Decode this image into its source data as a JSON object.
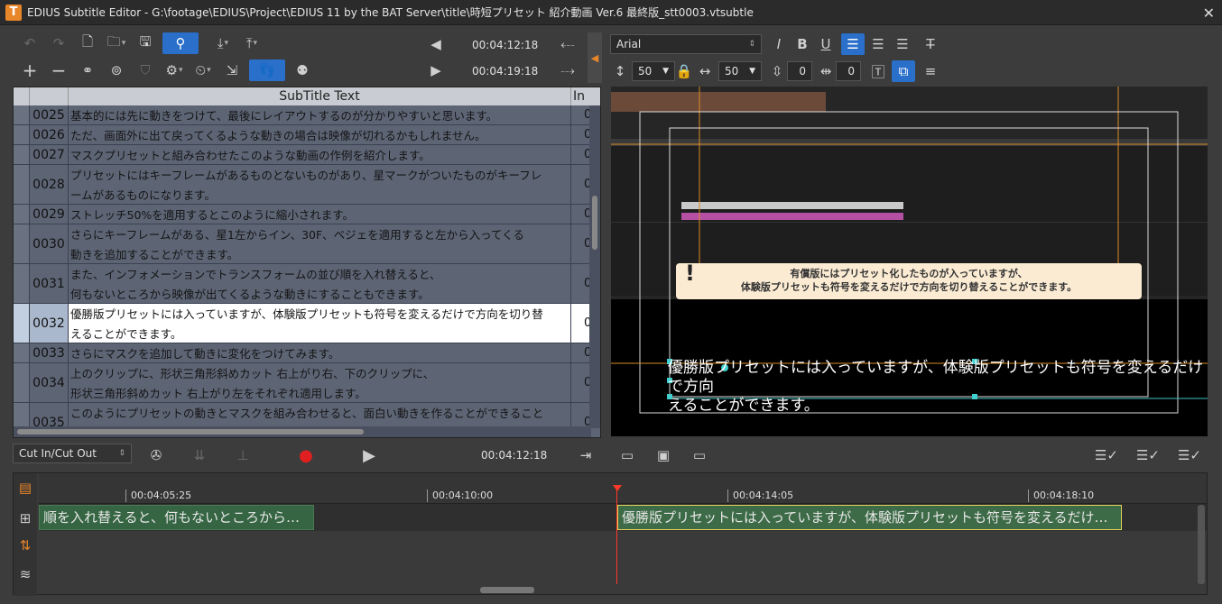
{
  "window": {
    "title": "EDIUS Subtitle Editor - G:\\footage\\EDIUS\\Project\\EDIUS 11 by the BAT Server\\title\\時短プリセット 紹介動画 Ver.6 最終版_stt0003.vtsubtle",
    "logo": "T",
    "close": "✕"
  },
  "toolbar": {
    "in_time": "00:04:12:18",
    "out_time": "00:04:19:18"
  },
  "sidebar_toggle": "◀",
  "format": {
    "font": "Arial",
    "size": "50",
    "width": "50",
    "spacing": "0",
    "indent": "0",
    "bold": "B",
    "italic": "I",
    "underline": "U"
  },
  "table": {
    "headers": {
      "text": "SubTitle Text",
      "in": "In"
    },
    "rows": [
      {
        "num": "0025",
        "text": "基本的には先に動きをつけて、最後にレイアウトするのが分かりやすいと思います。",
        "in": "0"
      },
      {
        "num": "0026",
        "text": "ただ、画面外に出て戻ってくるような動きの場合は映像が切れるかもしれません。",
        "in": "0"
      },
      {
        "num": "0027",
        "text": "マスクプリセットと組み合わせたこのような動画の作例を紹介します。",
        "in": "0"
      },
      {
        "num": "0028",
        "text": "プリセットにはキーフレームがあるものとないものがあり、星マークがついたものがキーフレ\nームがあるものになります。",
        "in": "0"
      },
      {
        "num": "0029",
        "text": "ストレッチ50%を適用するとこのように縮小されます。",
        "in": "0"
      },
      {
        "num": "0030",
        "text": "さらにキーフレームがある、星1左からイン、30F、ベジェを適用すると左から入ってくる\n動きを追加することができます。",
        "in": "0"
      },
      {
        "num": "0031",
        "text": "また、インフォメーションでトランスフォームの並び順を入れ替えると、\n何もないところから映像が出てくるような動きにすることもできます。",
        "in": "0"
      },
      {
        "num": "0032",
        "text": "優勝版プリセットには入っていますが、体験版プリセットも符号を変えるだけで方向を切り替\nえることができます。",
        "in": "0"
      },
      {
        "num": "0033",
        "text": "さらにマスクを追加して動きに変化をつけてみます。",
        "in": "0"
      },
      {
        "num": "0034",
        "text": "上のクリップに、形状三角形斜めカット 右上がり右、下のクリップに、\n形状三角形斜めカット 右上がり左をそれぞれ適用します。",
        "in": "0"
      },
      {
        "num": "0035",
        "text": "このようにプリセットの動きとマスクを組み合わせると、面白い動きを作ることができること",
        "in": "0"
      }
    ]
  },
  "preview": {
    "notice_line1": "有償版にはプリセット化したものが入っていますが、",
    "notice_line2": "体験版プリセットも符号を変えるだけで方向を切り替えることができます。",
    "notice_icon": "!",
    "subtitle": "優勝版プリセットには入っていますが、体験版プリセットも符号を変えるだけで方向\nえることができます。"
  },
  "controls": {
    "mode": "Cut In/Cut Out",
    "current_time": "00:04:12:18"
  },
  "timeline": {
    "ticks": [
      "00:04:05:25",
      "00:04:10:00",
      "00:04:14:05",
      "00:04:18:10"
    ],
    "clip1": "順を入れ替えると、何もないところから…",
    "clip2": "優勝版プリセットには入っていますが、体験版プリセットも符号を変えるだけ…"
  },
  "colors": {
    "accent": "#2a6fc9",
    "playhead": "#ff3a2a",
    "clip": "#356542",
    "selection_border": "#e3d25a"
  }
}
